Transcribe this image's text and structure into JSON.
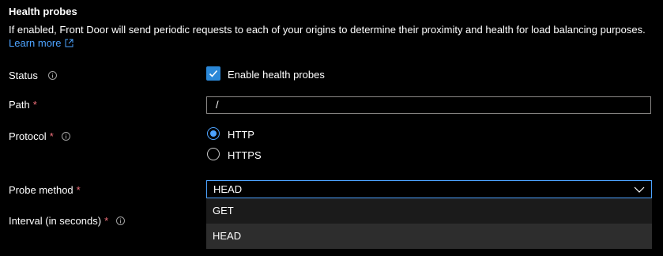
{
  "section": {
    "title": "Health probes",
    "description": "If enabled, Front Door will send periodic requests to each of your origins to determine their proximity and health for load balancing purposes.",
    "learn_more": "Learn more"
  },
  "status": {
    "label": "Status",
    "checkbox_label": "Enable health probes",
    "checked": true
  },
  "path": {
    "label": "Path",
    "required": "*",
    "value": "/"
  },
  "protocol": {
    "label": "Protocol",
    "required": "*",
    "options": [
      {
        "label": "HTTP",
        "selected": true
      },
      {
        "label": "HTTPS",
        "selected": false
      }
    ]
  },
  "probe_method": {
    "label": "Probe method",
    "required": "*",
    "value": "HEAD",
    "options": [
      "GET",
      "HEAD"
    ]
  },
  "interval": {
    "label": "Interval (in seconds)",
    "required": "*"
  },
  "colors": {
    "accent": "#4da3ff",
    "required": "#f1707b",
    "background": "#000000",
    "dropdown_bg": "#1b1b1b"
  },
  "icons": {
    "info": "info-icon",
    "external_link": "external-link-icon",
    "checkmark": "checkmark-icon",
    "chevron": "chevron-down-icon"
  }
}
